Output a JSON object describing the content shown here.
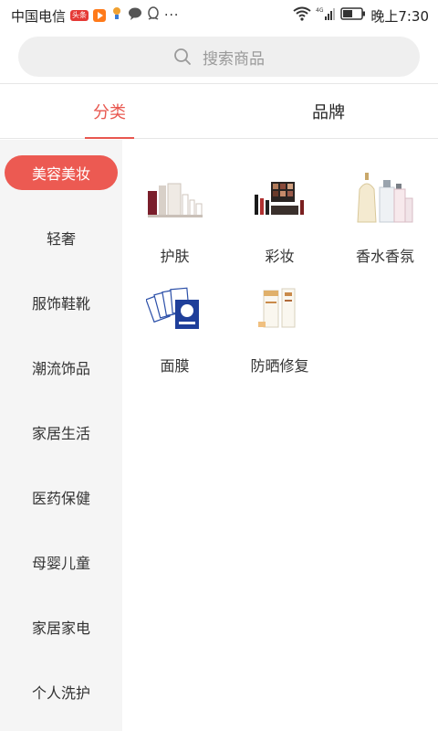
{
  "status_bar": {
    "carrier": "中国电信",
    "badge": "头条",
    "more": "···",
    "time": "晚上7:30",
    "network": "4G"
  },
  "search": {
    "placeholder": "搜索商品"
  },
  "tabs": [
    {
      "label": "分类",
      "active": true
    },
    {
      "label": "品牌",
      "active": false
    }
  ],
  "sidebar": {
    "items": [
      {
        "label": "美容美妆",
        "active": true
      },
      {
        "label": "轻奢",
        "active": false
      },
      {
        "label": "服饰鞋靴",
        "active": false
      },
      {
        "label": "潮流饰品",
        "active": false
      },
      {
        "label": "家居生活",
        "active": false
      },
      {
        "label": "医药保健",
        "active": false
      },
      {
        "label": "母婴儿童",
        "active": false
      },
      {
        "label": "家居家电",
        "active": false
      },
      {
        "label": "个人洗护",
        "active": false
      }
    ]
  },
  "categories": [
    {
      "label": "护肤",
      "icon": "skincare-products-icon"
    },
    {
      "label": "彩妆",
      "icon": "makeup-palette-icon"
    },
    {
      "label": "香水香氛",
      "icon": "perfume-bottles-icon"
    },
    {
      "label": "面膜",
      "icon": "face-mask-packs-icon"
    },
    {
      "label": "防晒修复",
      "icon": "sunscreen-icon"
    }
  ],
  "colors": {
    "accent": "#e8574f",
    "sidebar_bg": "#f5f5f5",
    "search_bg": "#efefef"
  }
}
